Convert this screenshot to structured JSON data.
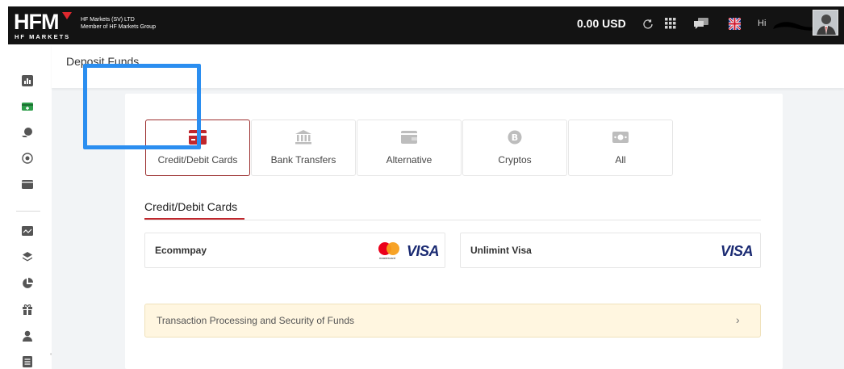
{
  "header": {
    "logo_text": "HFM",
    "logo_sub": "HF MARKETS",
    "company_line1": "HF Markets (SV) LTD",
    "company_line2": "Member of HF Markets Group",
    "balance": "0.00 USD",
    "greeting": "Hi",
    "icons": [
      "refresh-icon",
      "apps-grid-icon",
      "chat-icon",
      "uk-flag-icon",
      "avatar"
    ]
  },
  "sidebar": {
    "icons": [
      "bar-chart-icon",
      "deposit-icon",
      "withdraw-icon",
      "transfer-icon",
      "wallet-icon",
      "trading-chart-icon",
      "layers-icon",
      "pie-chart-icon",
      "gift-icon",
      "user-icon",
      "list-icon"
    ],
    "active_color": "#2e9e4a"
  },
  "page": {
    "title": "Deposit Funds"
  },
  "methods": [
    {
      "label": "Credit/Debit Cards",
      "icon": "credit-card-icon",
      "active": true
    },
    {
      "label": "Bank Transfers",
      "icon": "bank-icon",
      "active": false
    },
    {
      "label": "Alternative",
      "icon": "wallet-icon",
      "active": false
    },
    {
      "label": "Cryptos",
      "icon": "bitcoin-icon",
      "active": false
    },
    {
      "label": "All",
      "icon": "cash-icon",
      "active": false
    }
  ],
  "section": {
    "title": "Credit/Debit Cards"
  },
  "providers": [
    {
      "name": "Ecommpay",
      "logos": [
        "mastercard-logo",
        "visa-logo"
      ]
    },
    {
      "name": "Unlimint Visa",
      "logos": [
        "visa-logo"
      ]
    }
  ],
  "brand": {
    "visa_text": "VISA",
    "mastercard_text": "mastercard"
  },
  "notice": {
    "text": "Transaction Processing and Security of Funds",
    "chevron": "›"
  },
  "colors": {
    "accent_red": "#c0272d",
    "highlight_blue": "#2b8ef0",
    "topbar": "#131313",
    "notice_bg": "#fff6e0"
  }
}
